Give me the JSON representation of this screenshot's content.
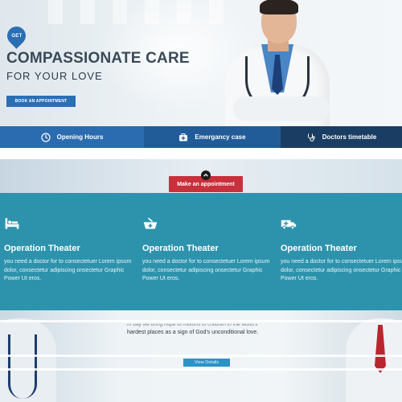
{
  "hero": {
    "badge": "GET",
    "title": "COMPASSIONATE CARE",
    "subtitle": "FOR YOUR LOVE",
    "cta_label": "BOOK AN APPOINTMENT"
  },
  "info_bar": {
    "items": [
      {
        "label": "Opening Hours",
        "icon": "clock-icon"
      },
      {
        "label": "Emergancy case",
        "icon": "medkit-icon"
      },
      {
        "label": "Doctors timetable",
        "icon": "stethoscope-icon"
      }
    ]
  },
  "appointment": {
    "button_label": "Make an appointment"
  },
  "services": [
    {
      "icon": "hospital-bed-icon",
      "title": "Operation Theater",
      "text": "you need a doctor for to consectetuer Lorem ipsum dolor, consectetur adipiscing onsectetur Graphic Power Ut eros."
    },
    {
      "icon": "medicine-bowl-icon",
      "title": "Operation Theater",
      "text": "you need a doctor for to consectetuer Lorem ipsum dolor, consectetur adipiscing onsectetur Graphic Power Ut eros."
    },
    {
      "icon": "ambulance-icon",
      "title": "Operation Theater",
      "text": "you need a doctor for to consectetuer Lorem ipsum dolor, consectetur adipiscing onsectetur Graphic Power Ut eros."
    }
  ],
  "bottom": {
    "quote_line_1": "m day we bring hope to millions of children in the world's",
    "quote_line_2": "hardest places as a sign of God's unconditional love.",
    "details_label": "View Details"
  },
  "colors": {
    "primary_blue": "#2b6cb0",
    "dark_blue": "#1a3d63",
    "teal": "#2d93ad",
    "red": "#c8303b"
  }
}
